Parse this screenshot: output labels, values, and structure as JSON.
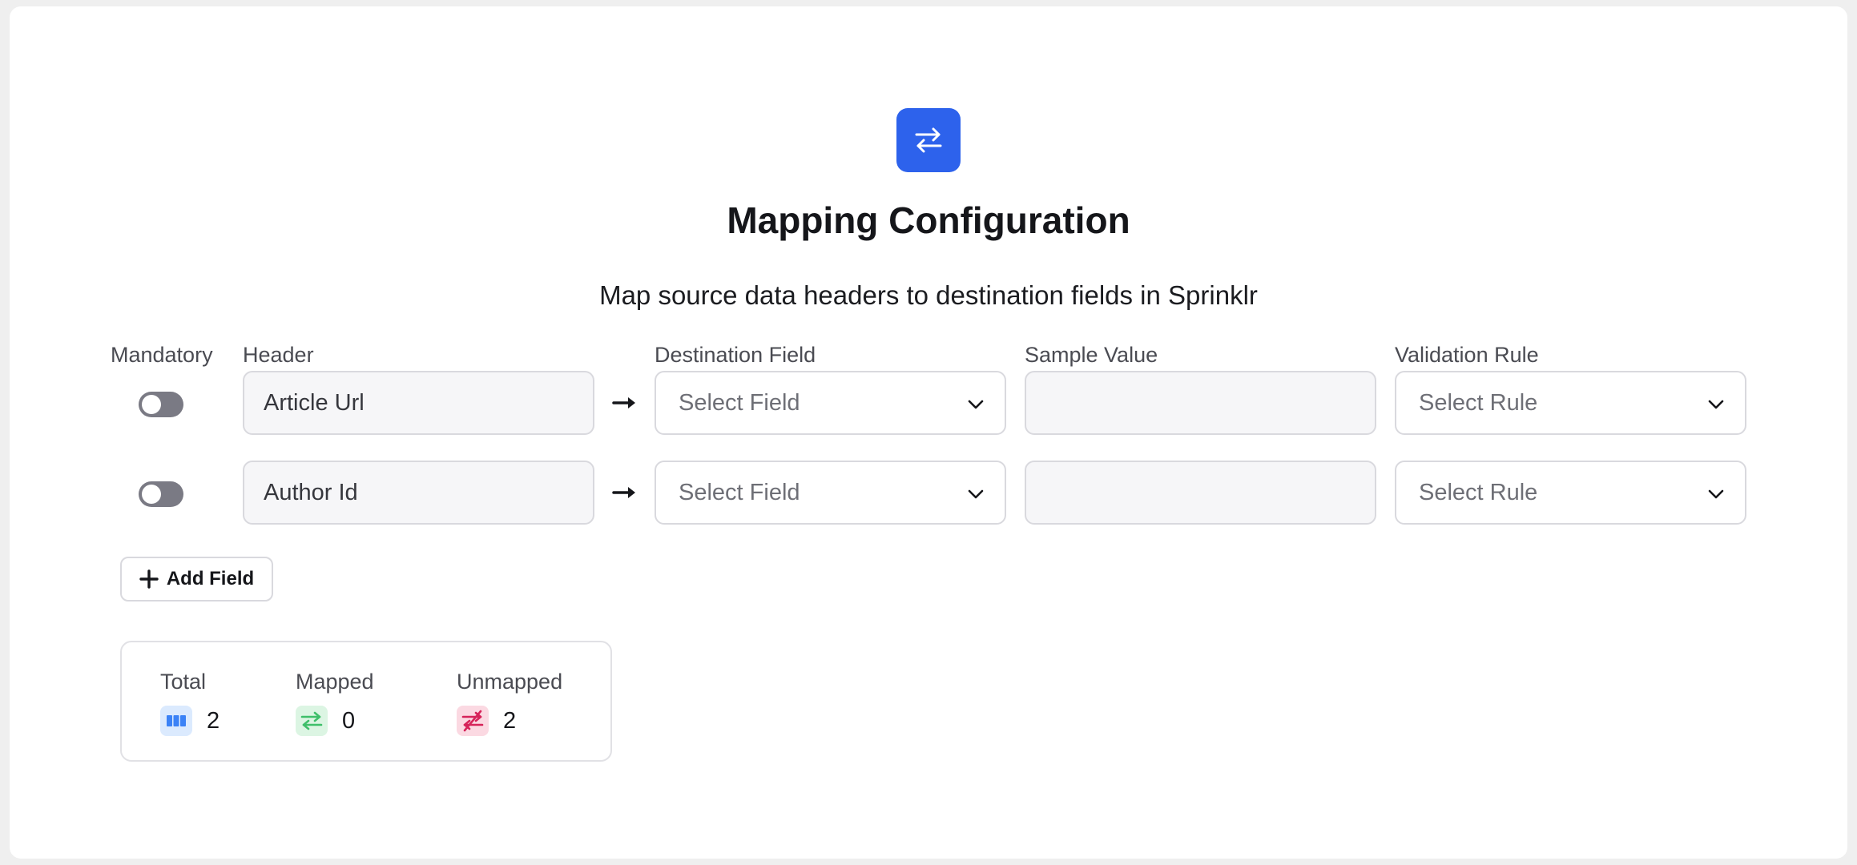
{
  "header": {
    "title": "Mapping Configuration",
    "subtitle": "Map source data headers to destination fields in Sprinklr"
  },
  "columns": {
    "mandatory": "Mandatory",
    "header": "Header",
    "destination": "Destination Field",
    "sample": "Sample Value",
    "validation": "Validation Rule"
  },
  "rows": [
    {
      "mandatory": false,
      "header": "Article Url",
      "destination_placeholder": "Select Field",
      "sample_value": "",
      "validation_placeholder": "Select Rule"
    },
    {
      "mandatory": false,
      "header": "Author Id",
      "destination_placeholder": "Select Field",
      "sample_value": "",
      "validation_placeholder": "Select Rule"
    }
  ],
  "actions": {
    "add_field": "Add Field"
  },
  "stats": {
    "total": {
      "label": "Total",
      "value": "2"
    },
    "mapped": {
      "label": "Mapped",
      "value": "0"
    },
    "unmapped": {
      "label": "Unmapped",
      "value": "2"
    }
  },
  "icons": {
    "hero": "swap-arrows-icon",
    "row_arrow": "arrow-right-icon",
    "chevron": "chevron-down-icon",
    "add": "plus-icon",
    "total": "columns-icon",
    "mapped": "swap-arrows-icon",
    "unmapped": "swap-arrows-off-icon"
  },
  "colors": {
    "accent": "#2d62ec",
    "total_badge_bg": "#dbeafe",
    "total_badge_fg": "#3b82f6",
    "mapped_badge_bg": "#dcf5e3",
    "mapped_badge_fg": "#3fbf6a",
    "unmapped_badge_bg": "#fbd9e2",
    "unmapped_badge_fg": "#d6245a"
  }
}
